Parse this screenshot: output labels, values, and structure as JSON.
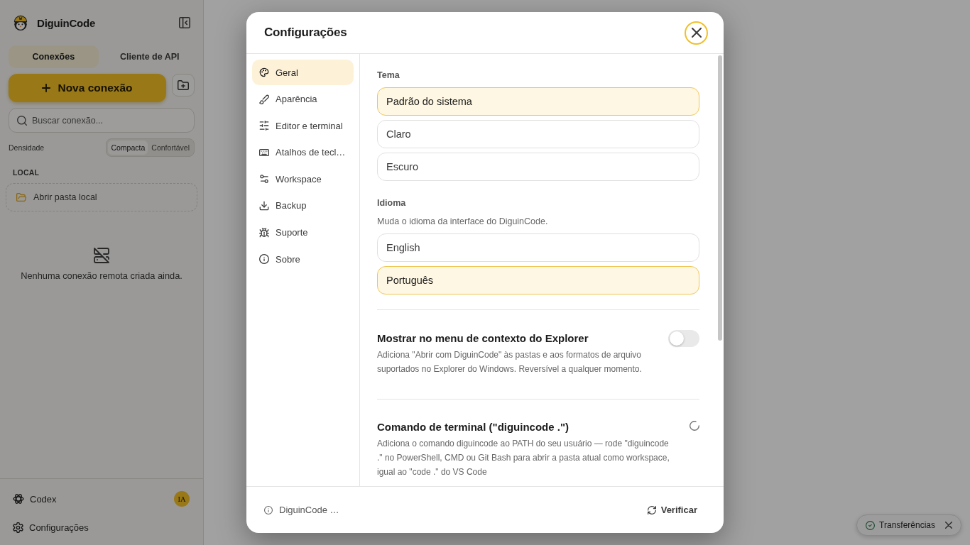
{
  "sidebar": {
    "app_name": "DiguinCode",
    "tabs": [
      {
        "label": "Conexões",
        "selected": true
      },
      {
        "label": "Cliente de API",
        "selected": false
      }
    ],
    "new_connection_button": "Nova conexão",
    "search": {
      "placeholder": "Buscar conexão..."
    },
    "density": {
      "label": "Densidade",
      "options": [
        {
          "label": "Compacta",
          "selected": true
        },
        {
          "label": "Confortável",
          "selected": false
        }
      ]
    },
    "local_section": {
      "title": "LOCAL",
      "open_folder": "Abrir pasta local"
    },
    "empty_state": "Nenhuma conexão remota criada ainda.",
    "bottom_items": [
      {
        "label": "Codex",
        "badge": "IA"
      },
      {
        "label": "Configurações"
      }
    ]
  },
  "settings_dialog": {
    "title": "Configurações",
    "nav": [
      {
        "label": "Geral",
        "selected": true
      },
      {
        "label": "Aparência",
        "selected": false
      },
      {
        "label": "Editor e terminal",
        "selected": false
      },
      {
        "label": "Atalhos de tecl…",
        "selected": false
      },
      {
        "label": "Workspace",
        "selected": false
      },
      {
        "label": "Backup",
        "selected": false
      },
      {
        "label": "Suporte",
        "selected": false
      },
      {
        "label": "Sobre",
        "selected": false
      }
    ],
    "theme": {
      "label": "Tema",
      "options": [
        {
          "label": "Padrão do sistema",
          "selected": true
        },
        {
          "label": "Claro",
          "selected": false
        },
        {
          "label": "Escuro",
          "selected": false
        }
      ]
    },
    "language": {
      "label": "Idioma",
      "description": "Muda o idioma da interface do DiguinCode.",
      "options": [
        {
          "label": "English",
          "selected": false
        },
        {
          "label": "Português",
          "selected": true
        }
      ]
    },
    "settings": [
      {
        "kind": "toggle",
        "title": "Mostrar no menu de contexto do Explorer",
        "description": "Adiciona \"Abrir com DiguinCode\" às pastas e aos formatos de arquivo suportados no Explorer do Windows. Reversível a qualquer momento.",
        "on": false
      },
      {
        "kind": "loading",
        "title": "Comando de terminal (\"diguincode .\")",
        "description": "Adiciona o comando diguincode ao PATH do seu usuário — rode \"diguincode .\" no PowerShell, CMD ou Git Bash para abrir a pasta atual como workspace, igual ao \"code .\" do VS Code"
      }
    ],
    "footer": {
      "version": "DiguinCode …",
      "check_button": "Verificar"
    }
  },
  "transfers": {
    "label": "Transferências"
  }
}
